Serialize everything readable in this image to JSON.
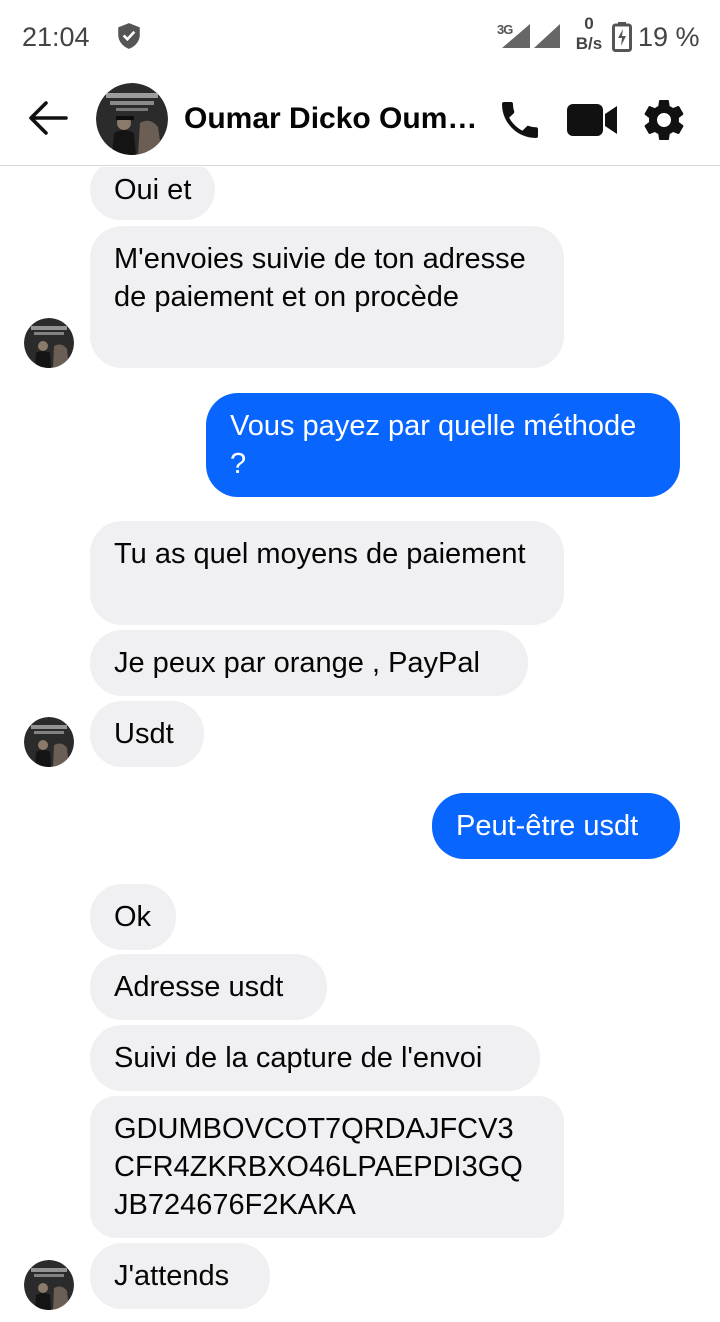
{
  "status_bar": {
    "time": "21:04",
    "network_type": "3G",
    "data_rate_value": "0",
    "data_rate_unit": "B/s",
    "battery_percent": "19 %"
  },
  "header": {
    "contact_name": "Oumar Dicko Oumar Dicko",
    "icons": [
      "back-arrow-icon",
      "phone-icon",
      "video-camera-icon",
      "gear-icon"
    ]
  },
  "messages": [
    {
      "direction": "in",
      "text": "Oui et"
    },
    {
      "direction": "in",
      "text": "M'envoies suivie de ton adresse de paiement et on procède"
    },
    {
      "direction": "out",
      "text": "Vous payez par quelle méthode ?"
    },
    {
      "direction": "in",
      "text": "Tu as quel moyens de paiement"
    },
    {
      "direction": "in",
      "text": "Je peux par orange , PayPal"
    },
    {
      "direction": "in",
      "text": "Usdt"
    },
    {
      "direction": "out",
      "text": "Peut-être usdt"
    },
    {
      "direction": "in",
      "text": "Ok"
    },
    {
      "direction": "in",
      "text": "Adresse usdt"
    },
    {
      "direction": "in",
      "text": "Suivi de la capture de l'envoi"
    },
    {
      "direction": "in",
      "text": "GDUMBOVCOT7QRDAJFCV3 CFR4ZKRBXO46LPAEPDI3GQ JB724676F2KAKA"
    },
    {
      "direction": "in",
      "text": "J'attends"
    }
  ],
  "colors": {
    "outgoing_bubble": "#0866ff",
    "incoming_bubble": "#f0f0f2",
    "icon_dark": "#111111"
  }
}
